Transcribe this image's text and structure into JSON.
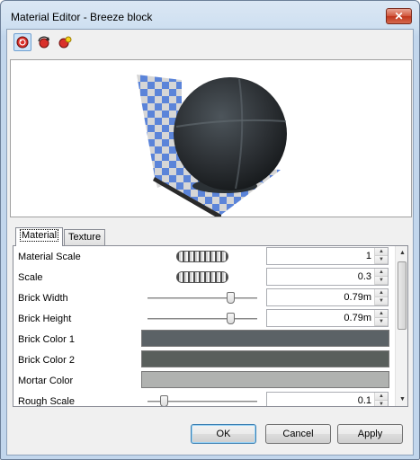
{
  "window": {
    "title": "Material Editor - Breeze block",
    "close_glyph": "✕"
  },
  "toolbar": {
    "buttons": [
      {
        "icon": "sphere-preview-icon",
        "active": true
      },
      {
        "icon": "rotate-preview-icon",
        "active": false
      },
      {
        "icon": "light-preview-icon",
        "active": false
      }
    ]
  },
  "tabs": [
    {
      "label": "Material",
      "active": true
    },
    {
      "label": "Texture",
      "active": false
    }
  ],
  "properties": [
    {
      "label": "Material Scale",
      "control": "jog",
      "value": "1"
    },
    {
      "label": "Scale",
      "control": "jog",
      "value": "0.3"
    },
    {
      "label": "Brick Width",
      "control": "slider",
      "slider_pos": 0.78,
      "value": "0.79m"
    },
    {
      "label": "Brick Height",
      "control": "slider",
      "slider_pos": 0.78,
      "value": "0.79m"
    },
    {
      "label": "Brick Color 1",
      "control": "color",
      "color": "#5b6266"
    },
    {
      "label": "Brick Color 2",
      "control": "color",
      "color": "#595f5c"
    },
    {
      "label": "Mortar Color",
      "control": "color",
      "color": "#b0b2b0"
    },
    {
      "label": "Rough Scale",
      "control": "slider",
      "slider_pos": 0.12,
      "value": "0.1"
    }
  ],
  "buttons": {
    "ok": "OK",
    "cancel": "Cancel",
    "apply": "Apply"
  },
  "colors": {
    "checker_blue": "#5b84d9",
    "checker_gray": "#d4d4d4",
    "sphere": "#2e3236"
  }
}
